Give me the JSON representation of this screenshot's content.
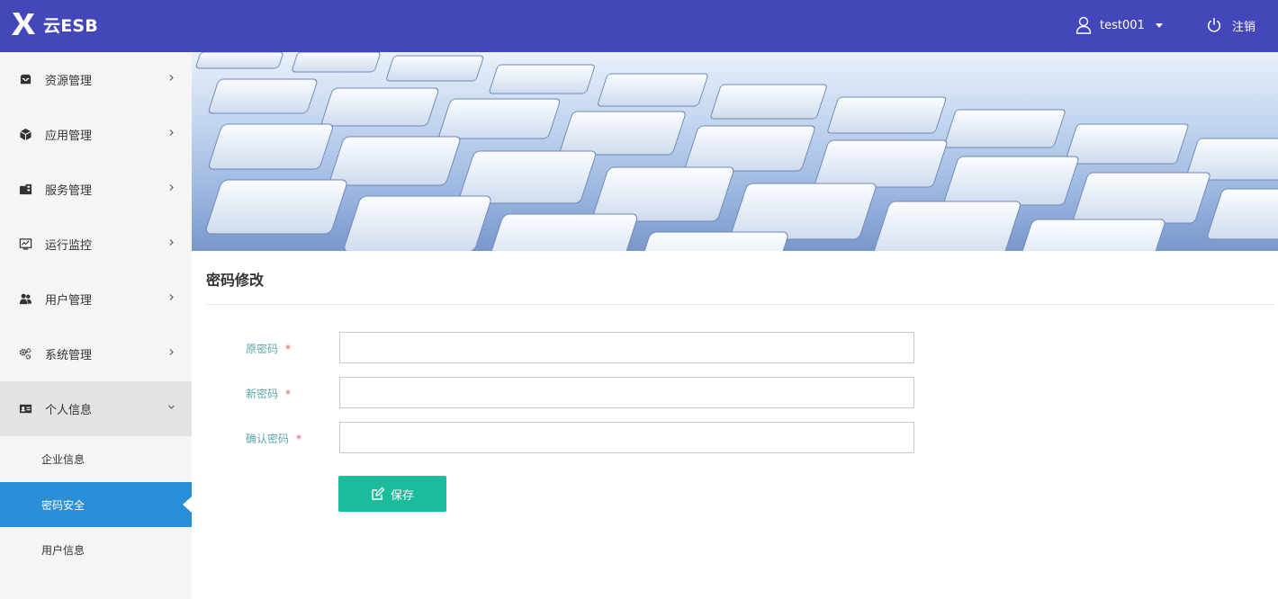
{
  "header": {
    "app_name": "云ESB",
    "username": "test001",
    "logout_label": "注销"
  },
  "sidebar": {
    "items": [
      {
        "label": "资源管理",
        "icon": "inbox-icon"
      },
      {
        "label": "应用管理",
        "icon": "cube-icon"
      },
      {
        "label": "服务管理",
        "icon": "service-icon"
      },
      {
        "label": "运行监控",
        "icon": "monitor-chart-icon"
      },
      {
        "label": "用户管理",
        "icon": "users-icon"
      },
      {
        "label": "系统管理",
        "icon": "gears-icon"
      },
      {
        "label": "个人信息",
        "icon": "id-card-icon",
        "expanded": true
      }
    ],
    "subitems": [
      {
        "label": "企业信息"
      },
      {
        "label": "密码安全",
        "active": true
      },
      {
        "label": "用户信息"
      }
    ]
  },
  "main": {
    "title": "密码修改",
    "form": {
      "old_password_label": "原密码",
      "new_password_label": "新密码",
      "confirm_password_label": "确认密码",
      "required_mark": "*",
      "old_password_value": "",
      "new_password_value": "",
      "confirm_password_value": ""
    },
    "save_label": "保存"
  },
  "colors": {
    "header_bg": "#4447b9",
    "sidebar_bg": "#f5f5f5",
    "active_item": "#2a8ed9",
    "save_button": "#1bbc9b",
    "label_text": "#5aa7a7",
    "required_mark": "#e05a5a"
  }
}
